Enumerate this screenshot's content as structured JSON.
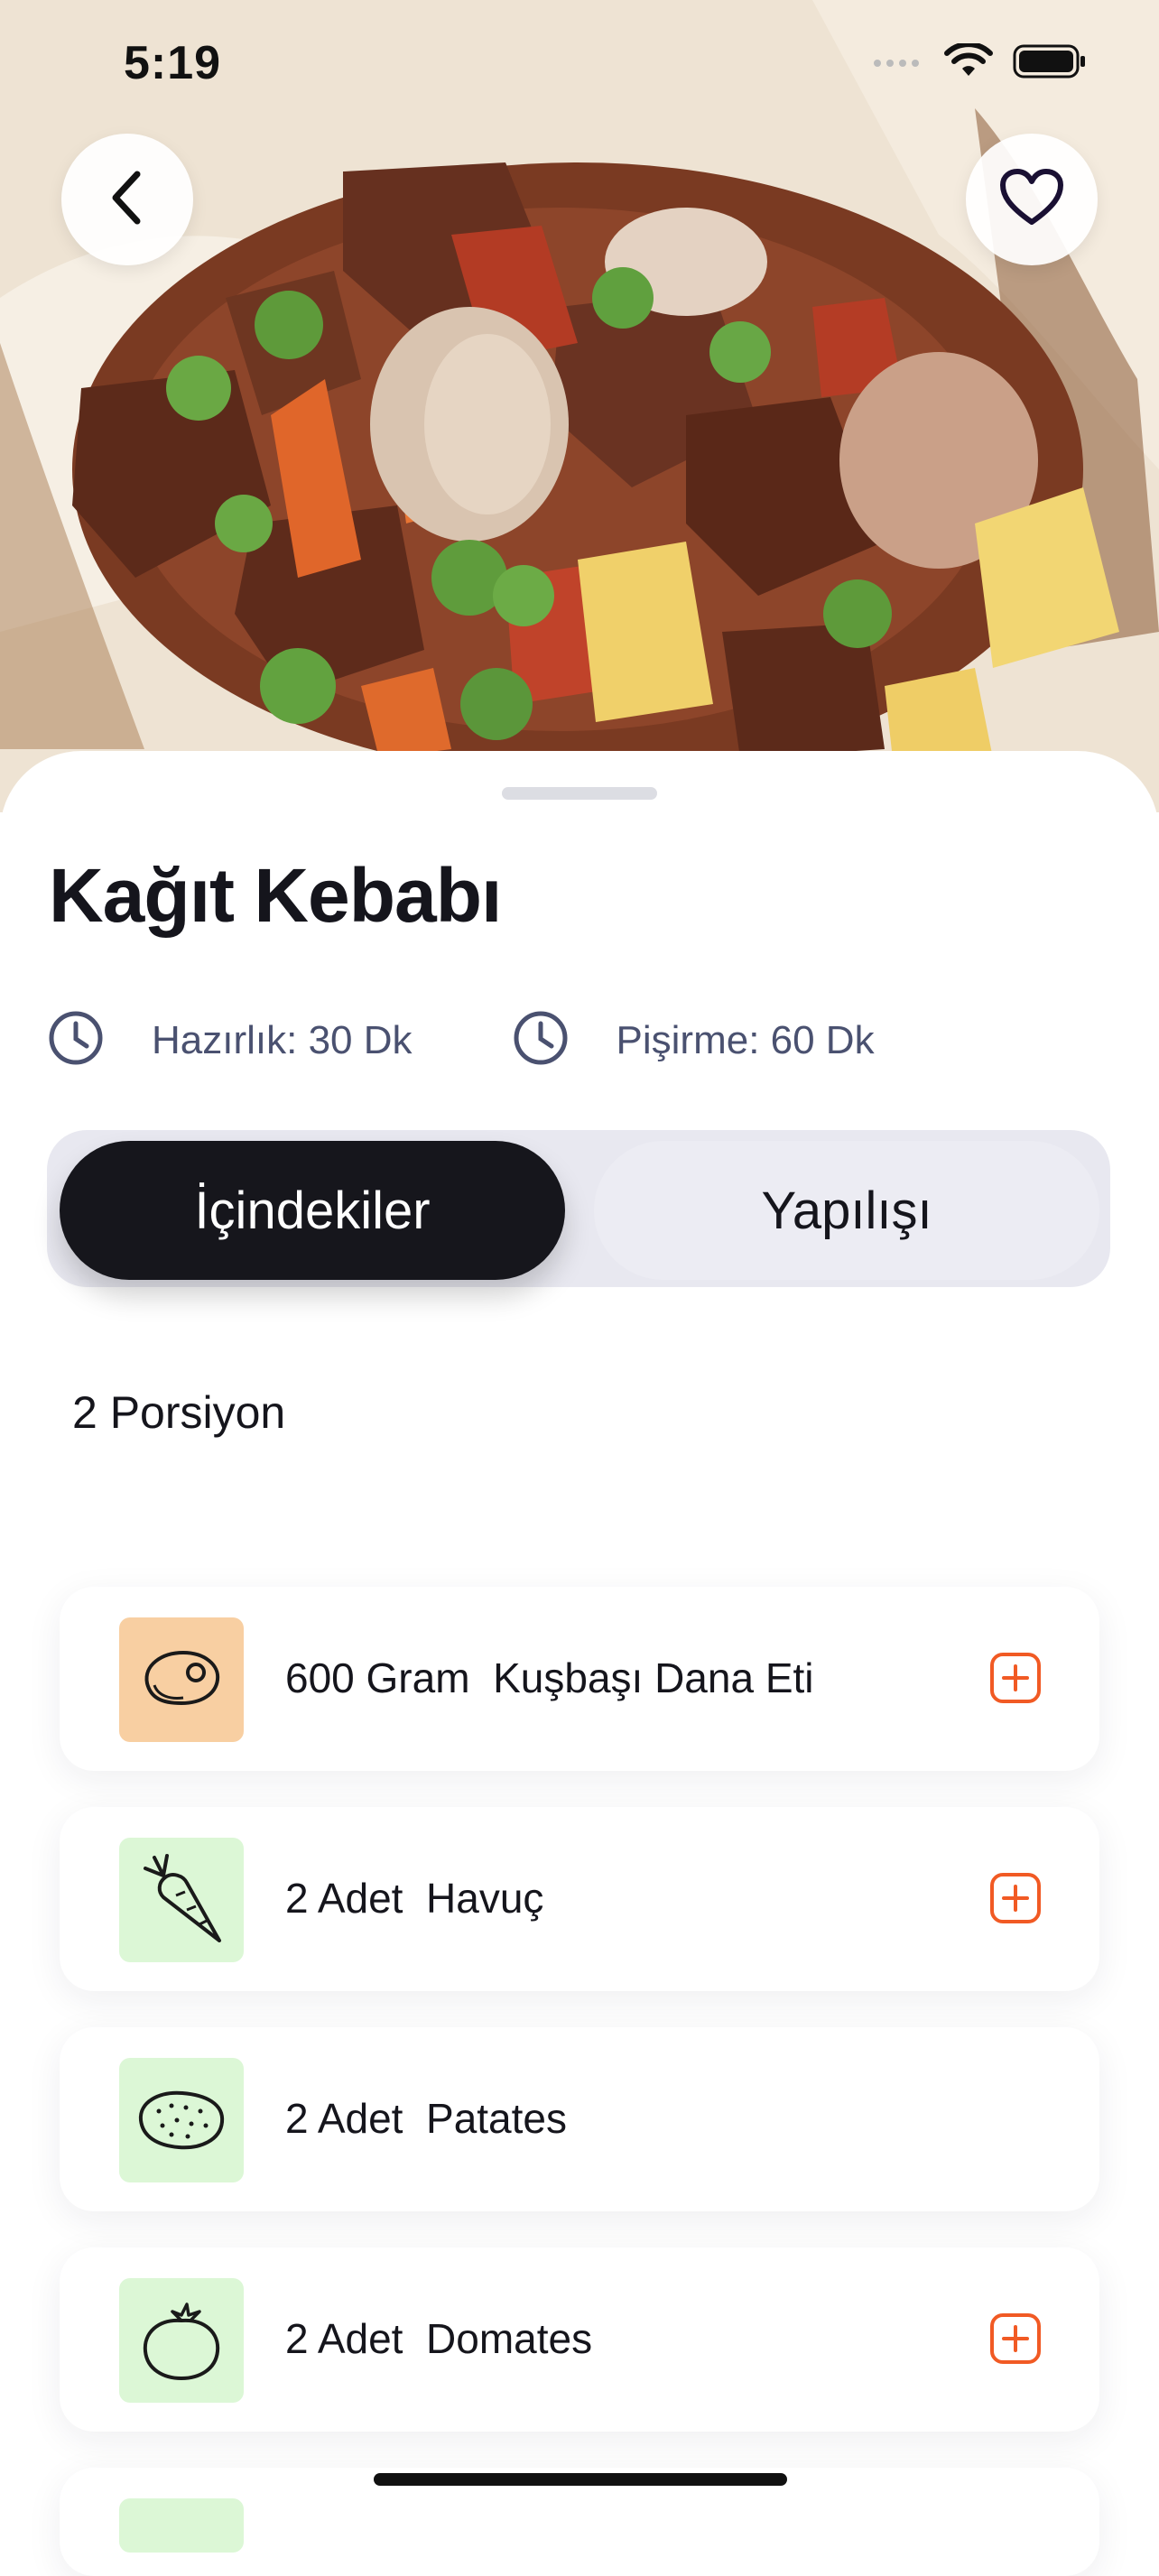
{
  "status_bar": {
    "time": "5:19",
    "icons": [
      "signal-icon",
      "wifi-icon",
      "battery-icon"
    ]
  },
  "nav": {
    "back_icon": "chevron-left-icon",
    "favorite_icon": "heart-icon"
  },
  "recipe": {
    "title": "Kağıt Kebabı",
    "prep_time": "Hazırlık: 30 Dk",
    "cook_time": "Pişirme: 60 Dk"
  },
  "tabs": [
    {
      "label": "İçindekiler",
      "active": true
    },
    {
      "label": "Yapılışı",
      "active": false
    }
  ],
  "servings": "2 Porsiyon",
  "ingredients": [
    {
      "label": "600 Gram  Kuşbaşı Dana Eti",
      "icon": "meat-icon",
      "thumb_color": "#f8cfa2",
      "has_add": true
    },
    {
      "label": "2 Adet  Havuç",
      "icon": "carrot-icon",
      "thumb_color": "#dcf7d6",
      "has_add": true
    },
    {
      "label": "2 Adet  Patates",
      "icon": "potato-icon",
      "thumb_color": "#dcf7d6",
      "has_add": false
    },
    {
      "label": "2 Adet  Domates",
      "icon": "tomato-icon",
      "thumb_color": "#dcf7d6",
      "has_add": true
    }
  ],
  "colors": {
    "accent": "#f15a24",
    "dark": "#16161c",
    "muted_text": "#4a5170"
  }
}
